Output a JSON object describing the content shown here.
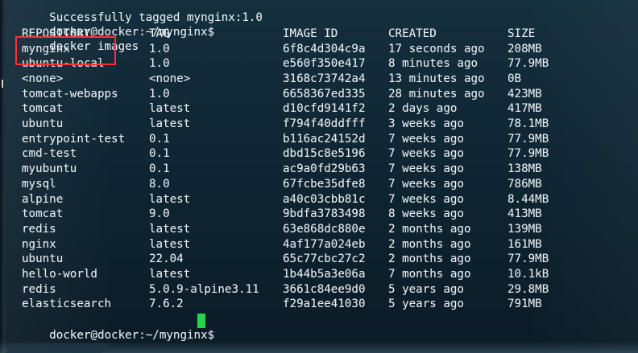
{
  "terminal": {
    "previous_output": "Successfully tagged mynginx:1.0",
    "prompt": "docker@docker:~/mynginx$",
    "command": "docker images",
    "headers": {
      "repository": "REPOSITORY",
      "tag": "TAG",
      "image_id": "IMAGE ID",
      "created": "CREATED",
      "size": "SIZE"
    },
    "rows": [
      {
        "repository": "mynginx",
        "tag": "1.0",
        "image_id": "6f8c4d304c9a",
        "created": "17 seconds ago",
        "size": "208MB"
      },
      {
        "repository": "ubuntu-local",
        "tag": "1.0",
        "image_id": "e560f350e417",
        "created": "8 minutes ago",
        "size": "77.9MB"
      },
      {
        "repository": "<none>",
        "tag": "<none>",
        "image_id": "3168c73742a4",
        "created": "13 minutes ago",
        "size": "0B"
      },
      {
        "repository": "tomcat-webapps",
        "tag": "1.0",
        "image_id": "6658367ed335",
        "created": "28 minutes ago",
        "size": "423MB"
      },
      {
        "repository": "tomcat",
        "tag": "latest",
        "image_id": "d10cfd9141f2",
        "created": "2 days ago",
        "size": "417MB"
      },
      {
        "repository": "ubuntu",
        "tag": "latest",
        "image_id": "f794f40ddfff",
        "created": "3 weeks ago",
        "size": "78.1MB"
      },
      {
        "repository": "entrypoint-test",
        "tag": "0.1",
        "image_id": "b116ac24152d",
        "created": "7 weeks ago",
        "size": "77.9MB"
      },
      {
        "repository": "cmd-test",
        "tag": "0.1",
        "image_id": "dbd15c8e5196",
        "created": "7 weeks ago",
        "size": "77.9MB"
      },
      {
        "repository": "myubuntu",
        "tag": "0.1",
        "image_id": "ac9a0fd29b63",
        "created": "7 weeks ago",
        "size": "138MB"
      },
      {
        "repository": "mysql",
        "tag": "8.0",
        "image_id": "67fcbe35dfe8",
        "created": "7 weeks ago",
        "size": "786MB"
      },
      {
        "repository": "alpine",
        "tag": "latest",
        "image_id": "a40c03cbb81c",
        "created": "7 weeks ago",
        "size": "8.44MB"
      },
      {
        "repository": "tomcat",
        "tag": "9.0",
        "image_id": "9bdfa3783498",
        "created": "8 weeks ago",
        "size": "413MB"
      },
      {
        "repository": "redis",
        "tag": "latest",
        "image_id": "63e868dc880e",
        "created": "2 months ago",
        "size": "139MB"
      },
      {
        "repository": "nginx",
        "tag": "latest",
        "image_id": "4af177a024eb",
        "created": "2 months ago",
        "size": "161MB"
      },
      {
        "repository": "ubuntu",
        "tag": "22.04",
        "image_id": "65c77cbc27c2",
        "created": "2 months ago",
        "size": "77.9MB"
      },
      {
        "repository": "hello-world",
        "tag": "latest",
        "image_id": "1b44b5a3e06a",
        "created": "7 months ago",
        "size": "10.1kB"
      },
      {
        "repository": "redis",
        "tag": "5.0.9-alpine3.11",
        "image_id": "3661c84ee9d0",
        "created": "5 years ago",
        "size": "29.8MB"
      },
      {
        "repository": "elasticsearch",
        "tag": "7.6.2",
        "image_id": "f29a1ee41030",
        "created": "5 years ago",
        "size": "791MB"
      }
    ],
    "highlight_color": "#ff3030",
    "cursor_color": "#28d24c",
    "text_color": "#e8eef2",
    "background_color": "#0f2533",
    "cursor_icon": "block-cursor"
  }
}
